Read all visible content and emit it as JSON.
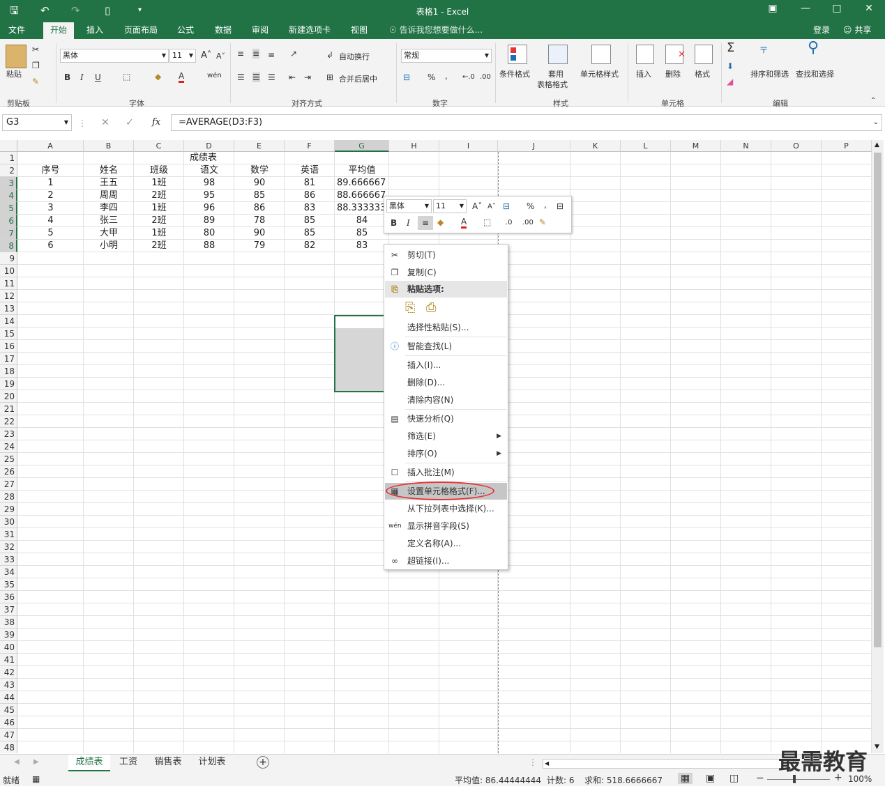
{
  "window": {
    "title": "表格1 - Excel",
    "login": "登录",
    "share": "共享"
  },
  "menu_tabs": [
    "文件",
    "开始",
    "插入",
    "页面布局",
    "公式",
    "数据",
    "审阅",
    "新建选项卡",
    "视图"
  ],
  "tell_me": "告诉我您想要做什么...",
  "ribbon": {
    "paste": "粘贴",
    "font_name": "黑体",
    "font_size": "11",
    "wrap": "自动换行",
    "merge": "合并后居中",
    "number_format": "常规",
    "cond_format": "条件格式",
    "table_fmt_1": "套用",
    "table_fmt_2": "表格格式",
    "cell_style": "单元格样式",
    "insert": "插入",
    "delete": "删除",
    "format": "格式",
    "sort_filter": "排序和筛选",
    "find_select": "查找和选择",
    "groups": [
      "剪贴板",
      "字体",
      "对齐方式",
      "数字",
      "样式",
      "单元格",
      "编辑"
    ],
    "icons": [
      "paste-icon",
      "cut-icon",
      "copy-icon",
      "format-painter-icon",
      "bold-icon",
      "italic-icon",
      "underline-icon",
      "border-icon",
      "fill-color-icon",
      "font-color-icon",
      "phonetic-icon",
      "grow-font-icon",
      "shrink-font-icon",
      "align-top-icon",
      "align-middle-icon",
      "align-bottom-icon",
      "orientation-icon",
      "align-left-icon",
      "align-center-icon",
      "align-right-icon",
      "decrease-indent-icon",
      "increase-indent-icon",
      "wrap-text-icon",
      "merge-icon",
      "currency-icon",
      "percent-icon",
      "comma-icon",
      "increase-decimal-icon",
      "decrease-decimal-icon",
      "sum-icon",
      "fill-icon",
      "clear-icon",
      "sort-filter-icon",
      "find-icon"
    ]
  },
  "formula_bar": {
    "name_box": "G3",
    "fx": "fx",
    "formula": "=AVERAGE(D3:F3)"
  },
  "columns": [
    "A",
    "B",
    "C",
    "D",
    "E",
    "F",
    "G",
    "H",
    "I",
    "J",
    "K",
    "L",
    "M",
    "N",
    "O",
    "P"
  ],
  "rows": [
    "1",
    "2",
    "3",
    "4",
    "5",
    "6",
    "7",
    "8",
    "9",
    "10",
    "11",
    "12",
    "13",
    "14",
    "15",
    "16",
    "17",
    "18",
    "19",
    "20",
    "21",
    "22",
    "23",
    "24",
    "25",
    "26",
    "27",
    "28",
    "29",
    "30",
    "31",
    "32",
    "33",
    "34",
    "35",
    "36",
    "37",
    "38",
    "39",
    "40",
    "41",
    "42",
    "43",
    "44",
    "45",
    "46",
    "47",
    "48"
  ],
  "sheet": {
    "title": "成绩表",
    "headers": [
      "序号",
      "姓名",
      "班级",
      "语文",
      "数学",
      "英语",
      "平均值"
    ],
    "data": [
      [
        "1",
        "王五",
        "1班",
        "98",
        "90",
        "81",
        "89.666667"
      ],
      [
        "2",
        "周周",
        "2班",
        "95",
        "85",
        "86",
        "88.666667"
      ],
      [
        "3",
        "李四",
        "1班",
        "96",
        "86",
        "83",
        "88.333333"
      ],
      [
        "4",
        "张三",
        "2班",
        "89",
        "78",
        "85",
        "84"
      ],
      [
        "5",
        "大甲",
        "1班",
        "80",
        "90",
        "85",
        "85"
      ],
      [
        "6",
        "小明",
        "2班",
        "88",
        "79",
        "82",
        "83"
      ]
    ]
  },
  "mini_toolbar": {
    "font": "黑体",
    "size": "11"
  },
  "context_menu": [
    {
      "label": "剪切(T)",
      "icon": "cut-icon"
    },
    {
      "label": "复制(C)",
      "icon": "copy-icon"
    },
    {
      "label": "粘贴选项:",
      "icon": "paste-options-icon"
    },
    {
      "label": "选择性粘贴(S)...",
      "icon": ""
    },
    {
      "label": "智能查找(L)",
      "icon": "smart-lookup-icon"
    },
    {
      "label": "插入(I)...",
      "icon": ""
    },
    {
      "label": "删除(D)...",
      "icon": ""
    },
    {
      "label": "清除内容(N)",
      "icon": ""
    },
    {
      "label": "快速分析(Q)",
      "icon": "quick-analysis-icon"
    },
    {
      "label": "筛选(E)",
      "icon": ""
    },
    {
      "label": "排序(O)",
      "icon": ""
    },
    {
      "label": "插入批注(M)",
      "icon": "comment-icon"
    },
    {
      "label": "设置单元格格式(F)...",
      "icon": "format-cells-icon"
    },
    {
      "label": "从下拉列表中选择(K)...",
      "icon": ""
    },
    {
      "label": "显示拼音字段(S)",
      "icon": "phonetic-icon"
    },
    {
      "label": "定义名称(A)...",
      "icon": ""
    },
    {
      "label": "超链接(I)...",
      "icon": "hyperlink-icon"
    }
  ],
  "sheet_tabs": [
    "成绩表",
    "工资",
    "销售表",
    "计划表"
  ],
  "status": {
    "ready": "就绪",
    "average": "平均值: 86.44444444",
    "count": "计数: 6",
    "sum": "求和: 518.6666667",
    "zoom": "100%"
  },
  "watermark": "最需教育",
  "colors": {
    "accent": "#217346",
    "highlight": "#e3363a"
  }
}
